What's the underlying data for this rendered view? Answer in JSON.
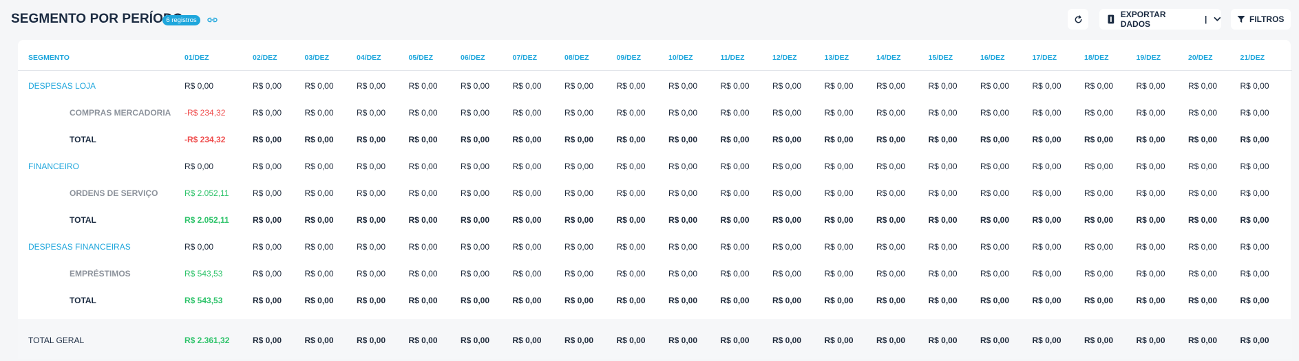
{
  "header": {
    "title": "SEGMENTO POR PERÍODO",
    "badge": "6 registros",
    "export_label": "EXPORTAR DADOS",
    "export_separator": "|",
    "filter_label": "FILTROS"
  },
  "colors": {
    "accent": "#1ea6dc",
    "negative": "#ef4c4c",
    "positive": "#2ec36a",
    "text_dark": "#1b2b41",
    "text_muted": "#8c929b"
  },
  "table": {
    "segment_header": "SEGMENTO",
    "columns": [
      "01/DEZ",
      "02/DEZ",
      "03/DEZ",
      "04/DEZ",
      "05/DEZ",
      "06/DEZ",
      "07/DEZ",
      "08/DEZ",
      "09/DEZ",
      "10/DEZ",
      "11/DEZ",
      "12/DEZ",
      "13/DEZ",
      "14/DEZ",
      "15/DEZ",
      "16/DEZ",
      "17/DEZ",
      "18/DEZ",
      "19/DEZ",
      "20/DEZ",
      "21/DEZ"
    ],
    "rows": [
      {
        "label": "DESPESAS LOJA",
        "kind": "group",
        "values": [
          "R$ 0,00",
          "R$ 0,00",
          "R$ 0,00",
          "R$ 0,00",
          "R$ 0,00",
          "R$ 0,00",
          "R$ 0,00",
          "R$ 0,00",
          "R$ 0,00",
          "R$ 0,00",
          "R$ 0,00",
          "R$ 0,00",
          "R$ 0,00",
          "R$ 0,00",
          "R$ 0,00",
          "R$ 0,00",
          "R$ 0,00",
          "R$ 0,00",
          "R$ 0,00",
          "R$ 0,00",
          "R$ 0,00"
        ]
      },
      {
        "label": "COMPRAS MERCADORIA",
        "kind": "item",
        "first_tone": "neg",
        "values": [
          "-R$ 234,32",
          "R$ 0,00",
          "R$ 0,00",
          "R$ 0,00",
          "R$ 0,00",
          "R$ 0,00",
          "R$ 0,00",
          "R$ 0,00",
          "R$ 0,00",
          "R$ 0,00",
          "R$ 0,00",
          "R$ 0,00",
          "R$ 0,00",
          "R$ 0,00",
          "R$ 0,00",
          "R$ 0,00",
          "R$ 0,00",
          "R$ 0,00",
          "R$ 0,00",
          "R$ 0,00",
          "R$ 0,00"
        ]
      },
      {
        "label": "TOTAL",
        "kind": "total",
        "first_tone": "neg",
        "values": [
          "-R$ 234,32",
          "R$ 0,00",
          "R$ 0,00",
          "R$ 0,00",
          "R$ 0,00",
          "R$ 0,00",
          "R$ 0,00",
          "R$ 0,00",
          "R$ 0,00",
          "R$ 0,00",
          "R$ 0,00",
          "R$ 0,00",
          "R$ 0,00",
          "R$ 0,00",
          "R$ 0,00",
          "R$ 0,00",
          "R$ 0,00",
          "R$ 0,00",
          "R$ 0,00",
          "R$ 0,00",
          "R$ 0,00"
        ]
      },
      {
        "label": "FINANCEIRO",
        "kind": "group",
        "values": [
          "R$ 0,00",
          "R$ 0,00",
          "R$ 0,00",
          "R$ 0,00",
          "R$ 0,00",
          "R$ 0,00",
          "R$ 0,00",
          "R$ 0,00",
          "R$ 0,00",
          "R$ 0,00",
          "R$ 0,00",
          "R$ 0,00",
          "R$ 0,00",
          "R$ 0,00",
          "R$ 0,00",
          "R$ 0,00",
          "R$ 0,00",
          "R$ 0,00",
          "R$ 0,00",
          "R$ 0,00",
          "R$ 0,00"
        ]
      },
      {
        "label": "ORDENS DE SERVIÇO",
        "kind": "item",
        "first_tone": "pos",
        "values": [
          "R$ 2.052,11",
          "R$ 0,00",
          "R$ 0,00",
          "R$ 0,00",
          "R$ 0,00",
          "R$ 0,00",
          "R$ 0,00",
          "R$ 0,00",
          "R$ 0,00",
          "R$ 0,00",
          "R$ 0,00",
          "R$ 0,00",
          "R$ 0,00",
          "R$ 0,00",
          "R$ 0,00",
          "R$ 0,00",
          "R$ 0,00",
          "R$ 0,00",
          "R$ 0,00",
          "R$ 0,00",
          "R$ 0,00"
        ]
      },
      {
        "label": "TOTAL",
        "kind": "total",
        "first_tone": "pos",
        "values": [
          "R$ 2.052,11",
          "R$ 0,00",
          "R$ 0,00",
          "R$ 0,00",
          "R$ 0,00",
          "R$ 0,00",
          "R$ 0,00",
          "R$ 0,00",
          "R$ 0,00",
          "R$ 0,00",
          "R$ 0,00",
          "R$ 0,00",
          "R$ 0,00",
          "R$ 0,00",
          "R$ 0,00",
          "R$ 0,00",
          "R$ 0,00",
          "R$ 0,00",
          "R$ 0,00",
          "R$ 0,00",
          "R$ 0,00"
        ]
      },
      {
        "label": "DESPESAS FINANCEIRAS",
        "kind": "group",
        "values": [
          "R$ 0,00",
          "R$ 0,00",
          "R$ 0,00",
          "R$ 0,00",
          "R$ 0,00",
          "R$ 0,00",
          "R$ 0,00",
          "R$ 0,00",
          "R$ 0,00",
          "R$ 0,00",
          "R$ 0,00",
          "R$ 0,00",
          "R$ 0,00",
          "R$ 0,00",
          "R$ 0,00",
          "R$ 0,00",
          "R$ 0,00",
          "R$ 0,00",
          "R$ 0,00",
          "R$ 0,00",
          "R$ 0,00"
        ]
      },
      {
        "label": "EMPRÉSTIMOS",
        "kind": "item",
        "first_tone": "pos",
        "values": [
          "R$ 543,53",
          "R$ 0,00",
          "R$ 0,00",
          "R$ 0,00",
          "R$ 0,00",
          "R$ 0,00",
          "R$ 0,00",
          "R$ 0,00",
          "R$ 0,00",
          "R$ 0,00",
          "R$ 0,00",
          "R$ 0,00",
          "R$ 0,00",
          "R$ 0,00",
          "R$ 0,00",
          "R$ 0,00",
          "R$ 0,00",
          "R$ 0,00",
          "R$ 0,00",
          "R$ 0,00",
          "R$ 0,00"
        ]
      },
      {
        "label": "TOTAL",
        "kind": "total",
        "first_tone": "pos",
        "values": [
          "R$ 543,53",
          "R$ 0,00",
          "R$ 0,00",
          "R$ 0,00",
          "R$ 0,00",
          "R$ 0,00",
          "R$ 0,00",
          "R$ 0,00",
          "R$ 0,00",
          "R$ 0,00",
          "R$ 0,00",
          "R$ 0,00",
          "R$ 0,00",
          "R$ 0,00",
          "R$ 0,00",
          "R$ 0,00",
          "R$ 0,00",
          "R$ 0,00",
          "R$ 0,00",
          "R$ 0,00",
          "R$ 0,00"
        ]
      }
    ],
    "grand_total": {
      "label": "TOTAL GERAL",
      "first_tone": "pos",
      "values": [
        "R$ 2.361,32",
        "R$ 0,00",
        "R$ 0,00",
        "R$ 0,00",
        "R$ 0,00",
        "R$ 0,00",
        "R$ 0,00",
        "R$ 0,00",
        "R$ 0,00",
        "R$ 0,00",
        "R$ 0,00",
        "R$ 0,00",
        "R$ 0,00",
        "R$ 0,00",
        "R$ 0,00",
        "R$ 0,00",
        "R$ 0,00",
        "R$ 0,00",
        "R$ 0,00",
        "R$ 0,00",
        "R$ 0,00"
      ]
    }
  }
}
